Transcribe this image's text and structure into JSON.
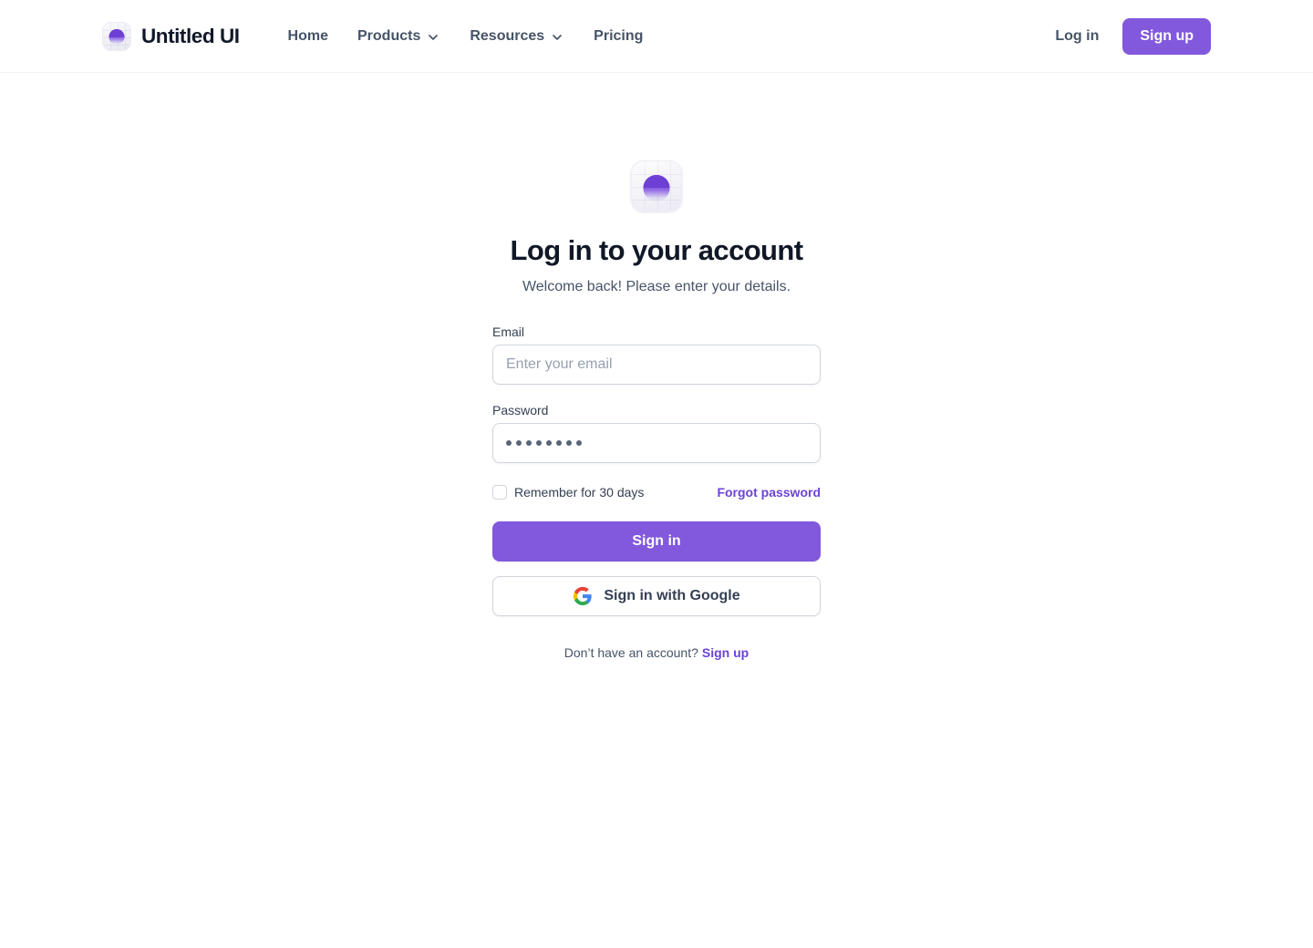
{
  "header": {
    "brand_name": "Untitled UI",
    "logo_icon": "untitled-ui-logo",
    "nav": [
      {
        "label": "Home",
        "has_dropdown": false
      },
      {
        "label": "Products",
        "has_dropdown": true
      },
      {
        "label": "Resources",
        "has_dropdown": true
      },
      {
        "label": "Pricing",
        "has_dropdown": false
      }
    ],
    "login_label": "Log in",
    "signup_label": "Sign up"
  },
  "main": {
    "logo_icon": "untitled-ui-logo",
    "title": "Log in to your account",
    "subtitle": "Welcome back! Please enter your details.",
    "form": {
      "email": {
        "label": "Email",
        "placeholder": "Enter your email",
        "value": ""
      },
      "password": {
        "label": "Password",
        "masked_value": "••••••••",
        "dot_count": 8
      },
      "remember_label": "Remember for 30 days",
      "remember_checked": false,
      "forgot_label": "Forgot password",
      "submit_label": "Sign in",
      "google_label": "Sign in with Google",
      "google_icon": "google-g-icon"
    },
    "footer": {
      "prompt": "Don’t have an account?",
      "link_label": "Sign up"
    }
  },
  "colors": {
    "primary": "#8258DD",
    "link": "#6C43D6",
    "heading": "#101828",
    "body_text": "#475467",
    "label_text": "#344054",
    "border": "#d0d5dd",
    "placeholder": "#97a0b0",
    "page_background": "#ffffff"
  }
}
